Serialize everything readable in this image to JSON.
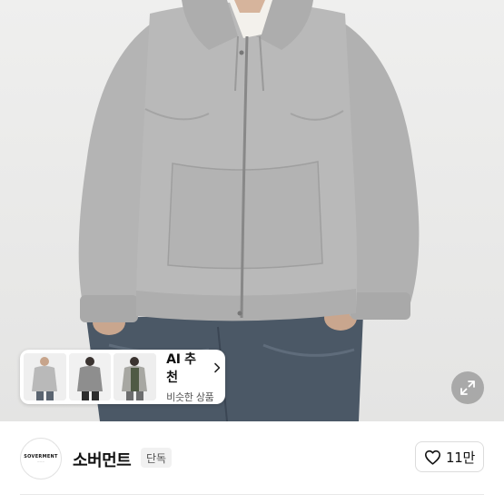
{
  "ai_card": {
    "title": "AI 추천",
    "subtitle": "비슷한 상품"
  },
  "brand": {
    "logo_text": "SOVERMENT",
    "name": "소버먼트",
    "badge": "단독"
  },
  "like": {
    "count": "11만"
  },
  "colors": {
    "hoodie": "#b8b8b8",
    "background": "#ededec",
    "jeans": "#4b5866"
  },
  "icons": {
    "chevron": "chevron-right-icon",
    "expand": "expand-icon",
    "like": "heart-outline-icon"
  }
}
